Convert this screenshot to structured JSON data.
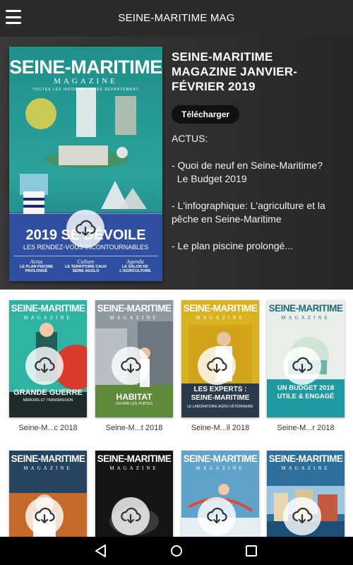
{
  "app": {
    "title": "SEINE-MARITIME MAG"
  },
  "icons": {
    "menu": "hamburger-menu-icon",
    "download": "cloud-download-icon",
    "back": "nav-back-icon",
    "home": "nav-home-icon",
    "recents": "nav-recents-icon"
  },
  "featured": {
    "title": "SEINE-MARITIME MAGAZINE JANVIER-FÉVRIER 2019",
    "download_label": "Télécharger",
    "description": [
      "ACTUS:",
      "- Quoi de neuf en Seine-Maritime?",
      "  Le Budget 2019",
      "- L'infographique: L'agriculture et la pêche en Seine-Maritime",
      "- Le plan piscine prolongé..."
    ],
    "cover": {
      "masthead": "SEINE-MARITIME",
      "sub": "MAGAZINE",
      "tagline": "TOUTES LES INFOS DE VOTRE DÉPARTEMENT",
      "headline": "2019 SE DÉVOILE",
      "subheadline": "LES RENDEZ-VOUS INCONTOURNABLES",
      "teasers": [
        {
          "kicker": "Actus",
          "text": "LE PLAN PISCINE PROLONGÉ"
        },
        {
          "kicker": "Culture",
          "text": "LE TERRITOIRE CAUX SEINE AGGLO"
        },
        {
          "kicker": "Agenda",
          "text": "LE SALON DE L'AGRICULTURE"
        }
      ]
    }
  },
  "issues": [
    {
      "label": "Seine-M...c 2018",
      "masthead": "SEINE-MARITIME",
      "sub": "MAGAZINE",
      "headline": "GRANDE GUERRE",
      "subheadline": "MÉMOIRE ET TRANSMISSION",
      "colors": {
        "bg": "#2fb3a3",
        "accent": "#d83a2c"
      }
    },
    {
      "label": "Seine-M...t 2018",
      "masthead": "SEINE-MARITIME",
      "sub": "MAGAZINE",
      "headline": "HABITAT",
      "subheadline": "OUVRIR LES PORTES",
      "colors": {
        "bg": "#8f9aa0",
        "accent": "#5f8a3a"
      }
    },
    {
      "label": "Seine-M...il 2018",
      "masthead": "SEINE-MARITIME",
      "sub": "MAGAZINE",
      "headline": "LES EXPERTS : SEINE-MARITIME",
      "subheadline": "LE LABORATOIRE AGRO-VÉTÉRINAIRE",
      "colors": {
        "bg": "#d9b21f",
        "accent": "#2a5fa8"
      }
    },
    {
      "label": "Seine-M...r 2018",
      "masthead": "SEINE-MARITIME",
      "sub": "MAGAZINE",
      "headline": "UN BUDGET 2018 UTILE & ENGAGÉ",
      "subheadline": "",
      "colors": {
        "bg": "#e9efe8",
        "accent": "#1f9aa0"
      }
    },
    {
      "label": "",
      "masthead": "SEINE-MARITIME",
      "sub": "MAGAZINE",
      "headline": "",
      "subheadline": "",
      "colors": {
        "bg": "#c56a2a",
        "accent": "#26435f"
      }
    },
    {
      "label": "",
      "masthead": "SEINE-MARITIME",
      "sub": "MAGAZINE",
      "headline": "",
      "subheadline": "",
      "colors": {
        "bg": "#151515",
        "accent": "#555555"
      }
    },
    {
      "label": "",
      "masthead": "SEINE-MARITIME",
      "sub": "MAGAZINE",
      "headline": "",
      "subheadline": "",
      "colors": {
        "bg": "#5fa3c9",
        "accent": "#e0483b"
      }
    },
    {
      "label": "",
      "masthead": "SEINE-MARITIME",
      "sub": "MAGAZINE",
      "headline": "",
      "subheadline": "",
      "colors": {
        "bg": "#2e6f9e",
        "accent": "#f2f2f2"
      }
    }
  ]
}
